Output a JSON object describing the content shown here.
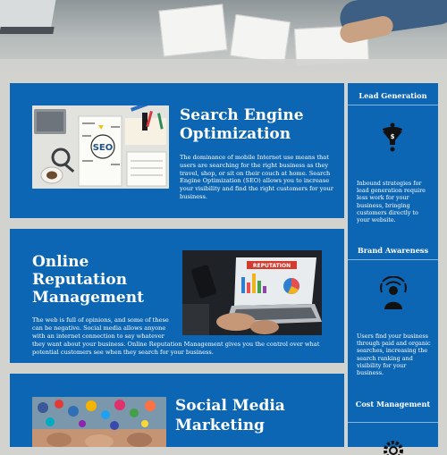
{
  "hero": {
    "alt": "team working with laptops and documents"
  },
  "cards": [
    {
      "title_line1": "Search Engine",
      "title_line2": "Optimization",
      "body": "The dominance of mobile Internet use means that users are searching for the right business as they travel, shop, or sit on their couch at home. Search Engine Optimization (SEO) allows you to increase your visibility and find the right customers for your business."
    },
    {
      "title_line1": "Online",
      "title_line2": "Reputation",
      "title_line3": "Management",
      "body_part1": "The web is full of opinions, and some of these can be negative. Social media allows anyone with an internet connection to say whatever",
      "body_part2": "they want about your business. Online Reputation Management gives you the control over what potential customers see when they search for your business.",
      "laptop_text": "REPUTATION"
    },
    {
      "title_line1": "Social Media",
      "title_line2": "Marketing"
    }
  ],
  "sidebar": {
    "sections": [
      {
        "heading": "Lead Generation",
        "text": "Inbound strategies for lead generation require less work for your business, bringing customers directly to your website.",
        "icon": "funnel-dollar-icon"
      },
      {
        "heading": "Brand Awareness",
        "text": "Users find your business through paid and organic searches, increasing the search ranking and visibility for your business.",
        "icon": "person-broadcast-icon"
      },
      {
        "heading": "Cost Management",
        "icon": "gear-icon"
      }
    ]
  },
  "seo_image_text": {
    "seo": "SEO"
  },
  "colors": {
    "accent": "#0c66b3",
    "background": "#d2d3cf"
  }
}
